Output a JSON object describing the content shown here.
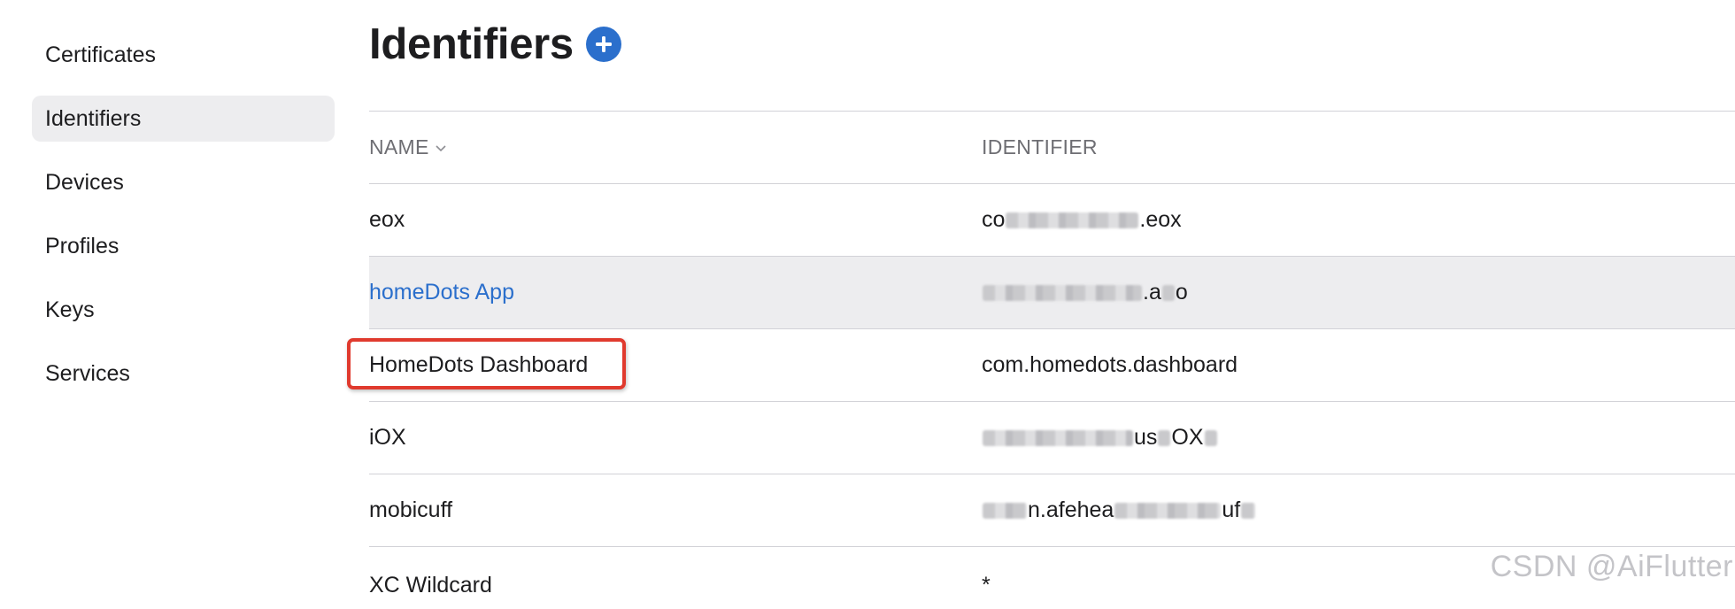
{
  "sidebar": {
    "items": [
      {
        "label": "Certificates",
        "active": false
      },
      {
        "label": "Identifiers",
        "active": true
      },
      {
        "label": "Devices",
        "active": false
      },
      {
        "label": "Profiles",
        "active": false
      },
      {
        "label": "Keys",
        "active": false
      },
      {
        "label": "Services",
        "active": false
      }
    ]
  },
  "header": {
    "title": "Identifiers",
    "add_icon": "plus-circle-icon"
  },
  "table": {
    "columns": {
      "name": "NAME",
      "name_sort_icon": "chevron-down-icon",
      "identifier": "IDENTIFIER"
    },
    "rows": [
      {
        "name": "eox",
        "id_prefix": "co",
        "id_suffix": ".eox"
      },
      {
        "name": "homeDots App",
        "id_prefix": "",
        "id_suffix": ".a",
        "id_tail": "o"
      },
      {
        "name": "HomeDots Dashboard",
        "id": "com.homedots.dashboard"
      },
      {
        "name": "iOX",
        "id_prefix": "",
        "id_suffix": "us",
        "id_tail": "OX"
      },
      {
        "name": "mobicuff",
        "id_prefix": "",
        "id_suffix": "n.afehea",
        "id_tail": "uf"
      },
      {
        "name": "XC Wildcard",
        "id": "*"
      }
    ]
  },
  "colors": {
    "accent": "#2b6fcc",
    "annotation": "#e03a2e",
    "selected_bg": "#ededef"
  },
  "watermark": "CSDN @AiFlutter"
}
